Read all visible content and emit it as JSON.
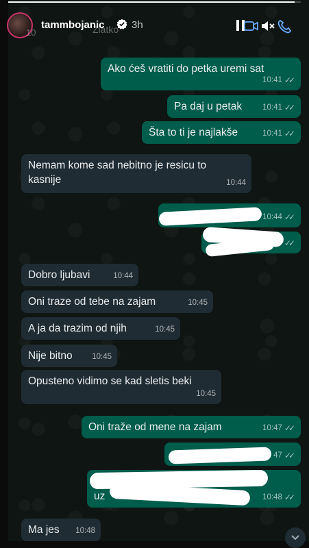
{
  "story": {
    "username": "tammbojanic",
    "time_ago": "3h",
    "ghost_back_count": "10",
    "ghost_contact_name": "Zlatko",
    "progress_fraction": 0.98
  },
  "messages": [
    {
      "dir": "out",
      "text": "Ako ćeš vratiti do petka uremi sat",
      "time": "10:41",
      "ticks": "✓✓"
    },
    {
      "dir": "out",
      "text": "Pa daj u petak",
      "time": "10:41",
      "ticks": "✓✓"
    },
    {
      "dir": "out",
      "text": "Šta to ti je najlakše",
      "time": "10:41",
      "ticks": "✓✓"
    },
    {
      "dir": "in",
      "text": "Nemam kome sad nebitno je resicu to kasnije",
      "time": "10:44"
    },
    {
      "dir": "out",
      "text": "",
      "time": "10:44",
      "ticks": "✓✓"
    },
    {
      "dir": "out",
      "text": "",
      "time": "",
      "ticks": "✓✓"
    },
    {
      "dir": "in",
      "text": "Dobro ljubavi",
      "time": "10:44"
    },
    {
      "dir": "in",
      "text": "Oni traze od tebe na zajam",
      "time": "10:45"
    },
    {
      "dir": "in",
      "text": "A ja da trazim od njih",
      "time": "10:45"
    },
    {
      "dir": "in",
      "text": "Nije bitno",
      "time": "10:45"
    },
    {
      "dir": "in",
      "text": "Opusteno vidimo se kad sletis beki",
      "time": "10:45"
    },
    {
      "dir": "out",
      "text": "Oni traže od mene na zajam",
      "time": "10:47",
      "ticks": "✓✓"
    },
    {
      "dir": "out",
      "text": "",
      "time": "47",
      "ticks": "✓✓"
    },
    {
      "dir": "out",
      "text": "uz",
      "time": "10:48",
      "ticks": "✓✓"
    },
    {
      "dir": "in",
      "text": "Ma jes",
      "time": "10:48"
    }
  ],
  "colors": {
    "outgoing_bubble": "#005c4b",
    "incoming_bubble": "#202c33",
    "avatar_ring": "#c7346c"
  },
  "icons": [
    "verified-badge-icon",
    "pause-icon",
    "video-call-icon",
    "mute-icon",
    "phone-icon",
    "scroll-down-icon"
  ]
}
